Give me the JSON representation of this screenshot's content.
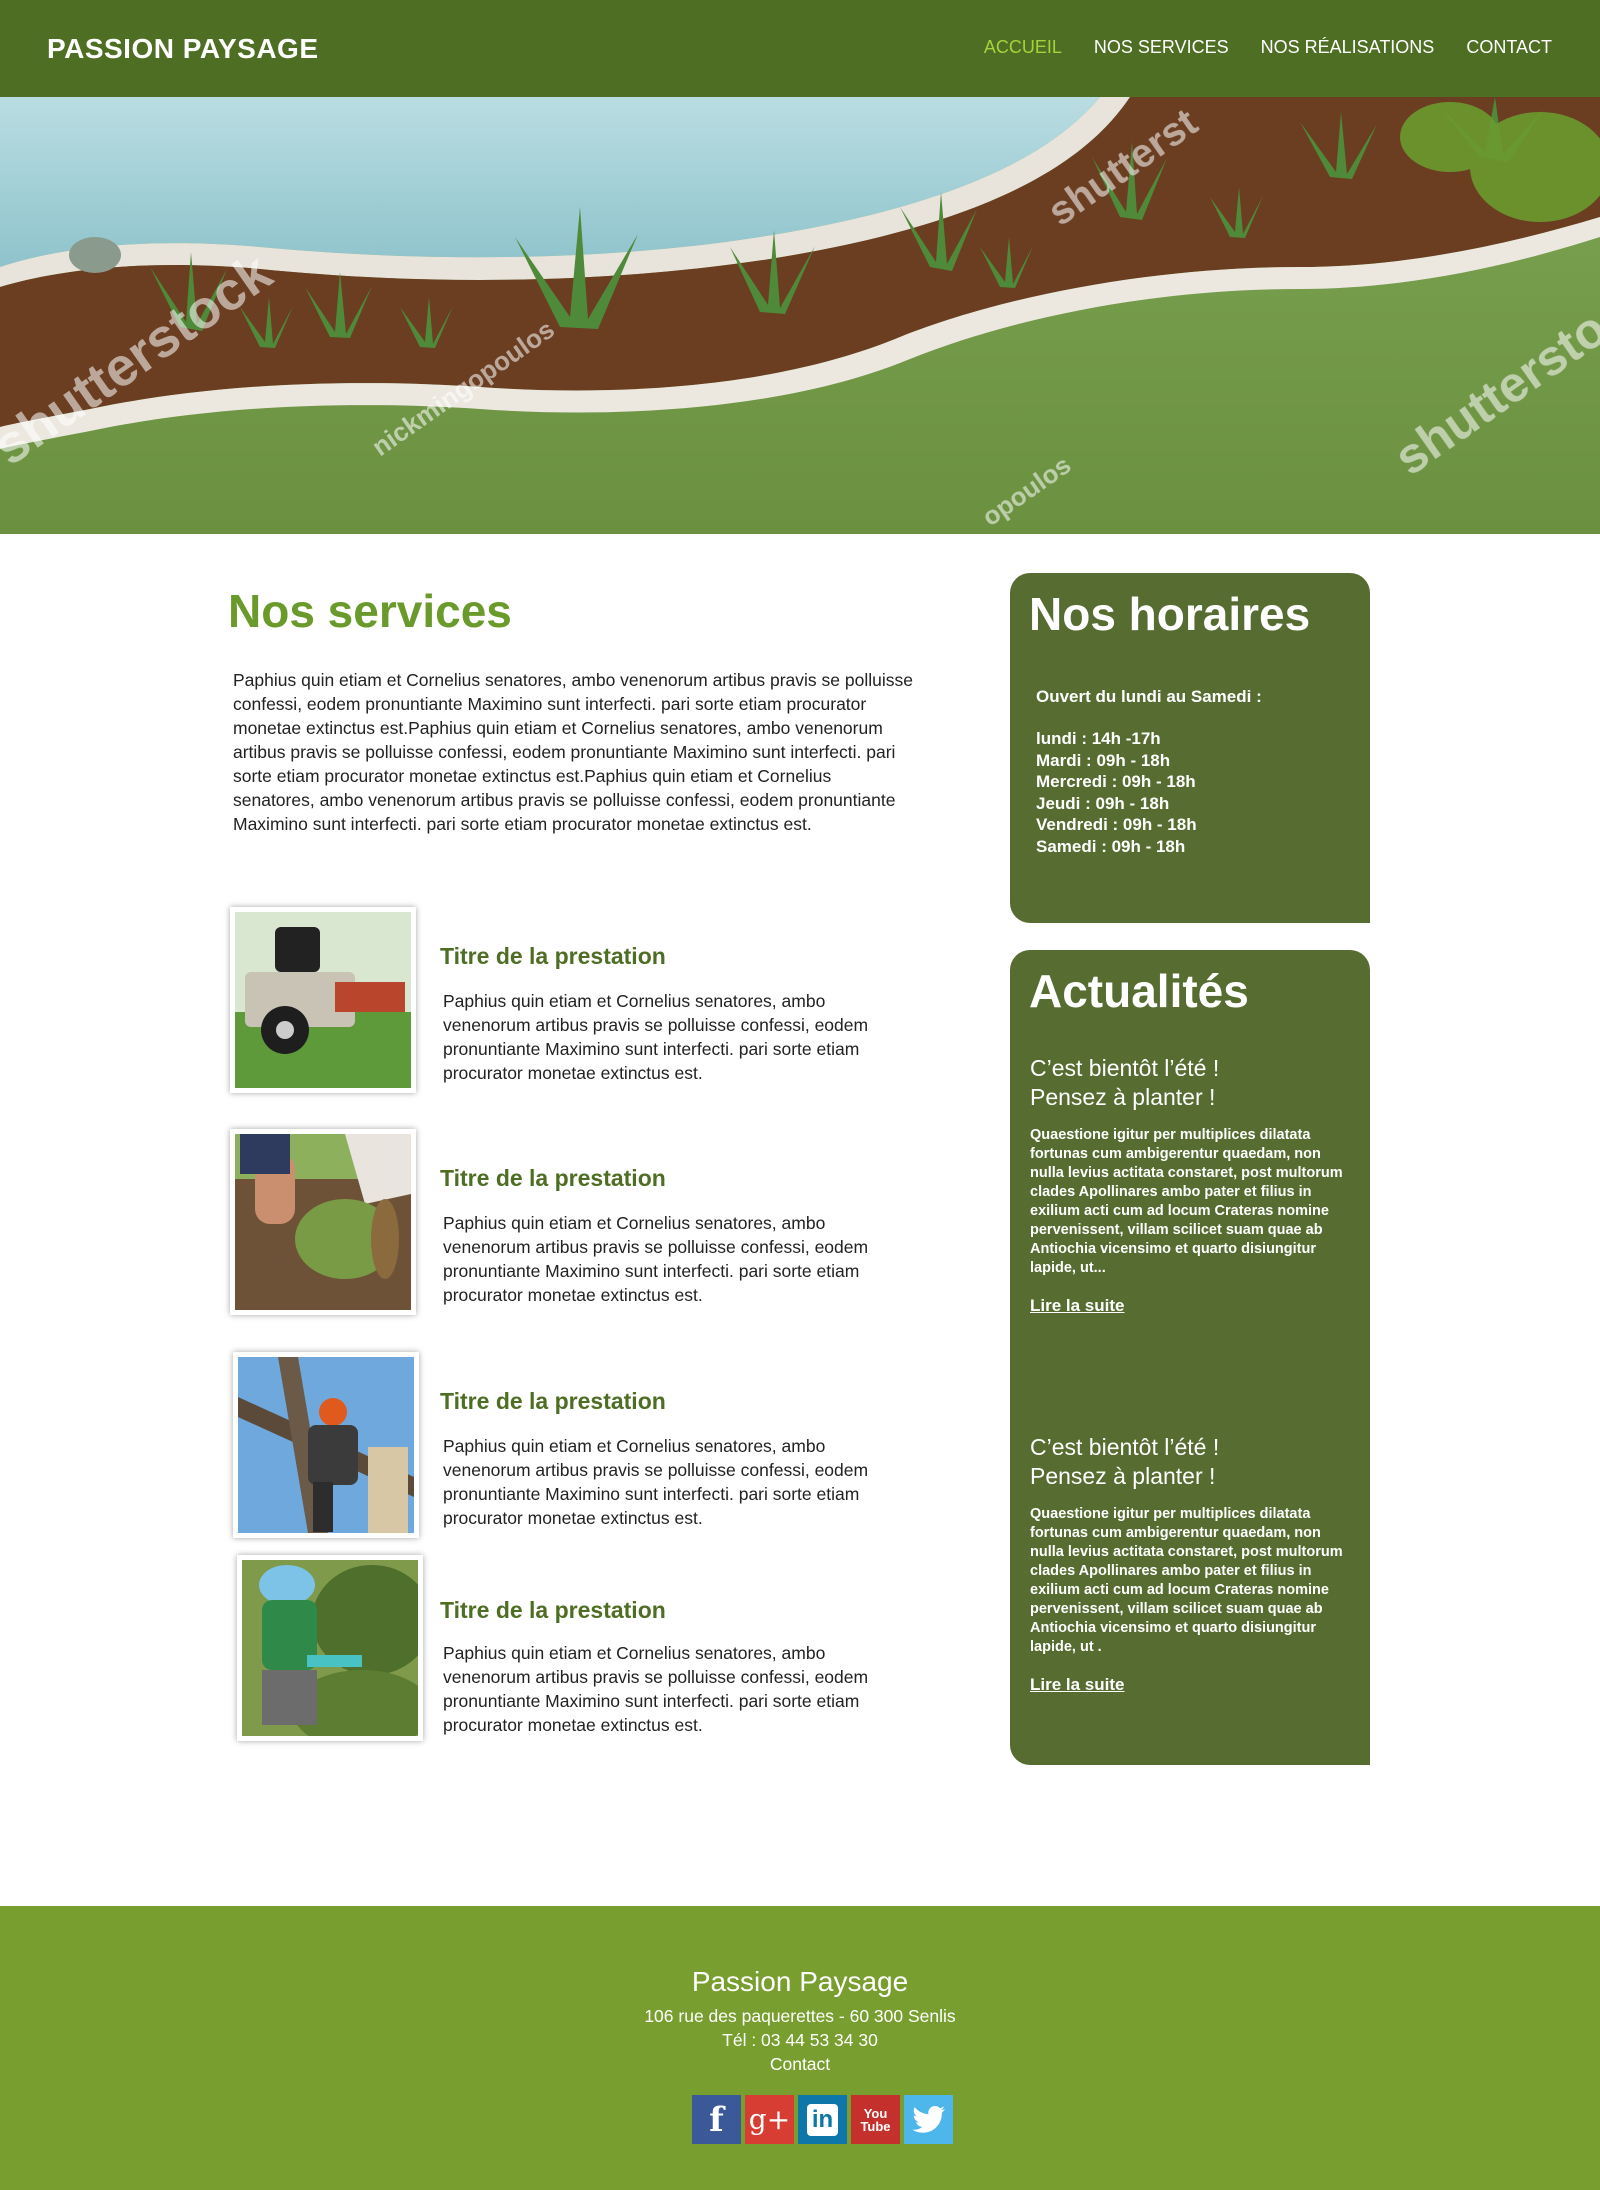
{
  "header": {
    "brand": "PASSION PAYSAGE",
    "nav": [
      {
        "label": "ACCUEIL",
        "active": true
      },
      {
        "label": "NOS SERVICES",
        "active": false
      },
      {
        "label": "NOS RÉALISATIONS",
        "active": false
      },
      {
        "label": "CONTACT",
        "active": false
      }
    ]
  },
  "colors": {
    "header_bg": "#4e6e24",
    "nav_active": "#a6d23c",
    "title_green": "#6b9a2c",
    "panel_bg": "#566c30",
    "footer_bg": "#779e2e"
  },
  "hero": {
    "watermarks": [
      "shutterstock",
      "nickmingopoulos",
      "shutterst",
      "opoulos"
    ]
  },
  "services": {
    "title": "Nos services",
    "intro": "Paphius quin etiam et Cornelius senatores, ambo venenorum artibus pravis se polluisse confessi, eodem pronuntiante Maximino sunt interfecti. pari sorte etiam procurator monetae extinctus est.Paphius quin etiam et Cornelius senatores, ambo venenorum artibus pravis se polluisse confessi, eodem pronuntiante Maximino sunt interfecti. pari sorte etiam procurator monetae extinctus est.Paphius quin etiam et Cornelius senatores, ambo venenorum artibus pravis se polluisse confessi, eodem pronuntiante Maximino sunt interfecti. pari sorte etiam procurator monetae extinctus est.",
    "items": [
      {
        "title": "Titre de la prestation",
        "text": "Paphius quin etiam et Cornelius senatores, ambo venenorum artibus pravis se polluisse confessi, eodem pronuntiante Maximino sunt interfecti. pari sorte etiam procurator monetae extinctus est.",
        "image": "lawn-mower-photo"
      },
      {
        "title": "Titre de la prestation",
        "text": "Paphius quin etiam et Cornelius senatores, ambo venenorum artibus pravis se polluisse confessi, eodem pronuntiante Maximino sunt interfecti. pari sorte etiam procurator monetae extinctus est.",
        "image": "turf-roll-photo"
      },
      {
        "title": "Titre de la prestation",
        "text": "Paphius quin etiam et Cornelius senatores, ambo venenorum artibus pravis se polluisse confessi, eodem pronuntiante Maximino sunt interfecti. pari sorte etiam procurator monetae extinctus est.",
        "image": "tree-pruning-photo"
      },
      {
        "title": "Titre de la prestation",
        "text": "Paphius quin etiam et Cornelius senatores, ambo venenorum artibus pravis se polluisse confessi, eodem pronuntiante Maximino sunt interfecti. pari sorte etiam procurator monetae extinctus est.",
        "image": "hedge-trimming-photo"
      }
    ]
  },
  "hours": {
    "title": "Nos horaires",
    "intro": "Ouvert du lundi au Samedi :",
    "lines": [
      "lundi : 14h -17h",
      "Mardi : 09h - 18h",
      "Mercredi : 09h - 18h",
      "Jeudi : 09h - 18h",
      "Vendredi : 09h - 18h",
      "Samedi : 09h - 18h"
    ]
  },
  "news": {
    "title": "Actualités",
    "items": [
      {
        "title_line1": "C’est bientôt l’été !",
        "title_line2": "Pensez à planter !",
        "text": "Quaestione igitur per multiplices dilatata fortunas cum ambigerentur quaedam, non nulla levius actitata constaret, post multorum clades Apollinares ambo pater et filius in exilium acti cum ad locum Crateras nomine pervenissent, villam scilicet suam quae ab Antiochia vicensimo et quarto disiungitur lapide, ut...",
        "link": "Lire la suite"
      },
      {
        "title_line1": "C’est bientôt l’été !",
        "title_line2": "Pensez à planter !",
        "text": "Quaestione igitur per multiplices dilatata fortunas cum ambigerentur quaedam, non nulla levius actitata constaret, post multorum clades Apollinares ambo pater et filius in exilium acti cum ad locum Crateras nomine pervenissent, villam scilicet suam quae ab Antiochia vicensimo et quarto disiungitur lapide, ut .",
        "link": "Lire la suite"
      }
    ]
  },
  "footer": {
    "name": "Passion Paysage",
    "address": "106 rue des paquerettes - 60 300 Senlis",
    "phone": "Tél : 03 44 53 34 30",
    "contact": "Contact",
    "socials": [
      {
        "icon": "facebook-icon",
        "glyph": "f",
        "color": "#3b5998"
      },
      {
        "icon": "google-plus-icon",
        "glyph": "g+",
        "color": "#d73d32"
      },
      {
        "icon": "linkedin-icon",
        "glyph": "in",
        "color": "#0e76a8"
      },
      {
        "icon": "youtube-icon",
        "glyph": "You Tube",
        "color": "#c4302b"
      },
      {
        "icon": "twitter-icon",
        "glyph": "🐦",
        "color": "#4db7ec"
      }
    ]
  }
}
